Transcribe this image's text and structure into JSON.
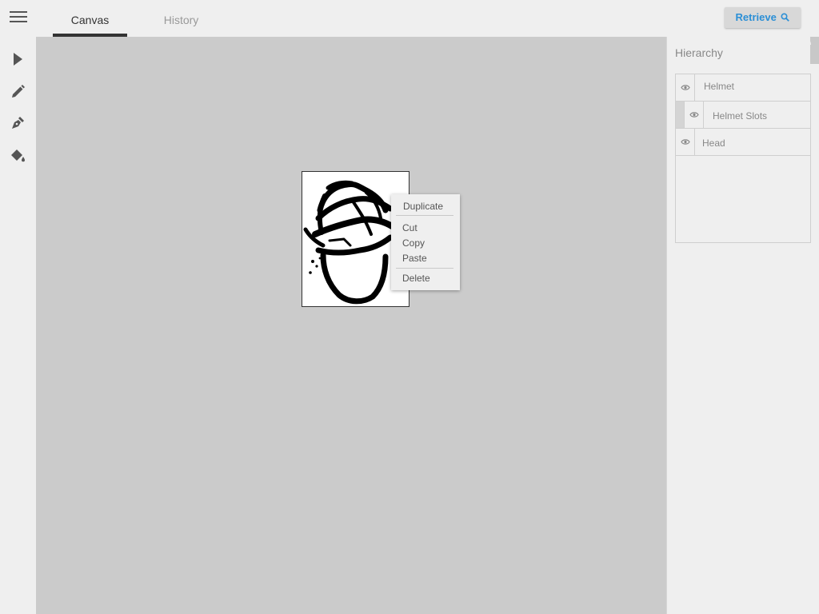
{
  "header": {
    "tabs": [
      {
        "label": "Canvas",
        "active": true
      },
      {
        "label": "History",
        "active": false
      }
    ],
    "retrieve_label": "Retrieve",
    "accent_color": "#2b8fd6"
  },
  "toolbar": {
    "tools": [
      "select-arrow-icon",
      "pencil-icon",
      "pen-nib-icon",
      "paint-bucket-icon"
    ]
  },
  "context_menu": {
    "items": [
      "Duplicate",
      "Cut",
      "Copy",
      "Paste",
      "Delete"
    ]
  },
  "hierarchy": {
    "title": "Hierarchy",
    "layers": [
      {
        "label": "Helmet",
        "indent": 0
      },
      {
        "label": "Helmet Slots",
        "indent": 1
      },
      {
        "label": "Head",
        "indent": 0
      }
    ]
  }
}
